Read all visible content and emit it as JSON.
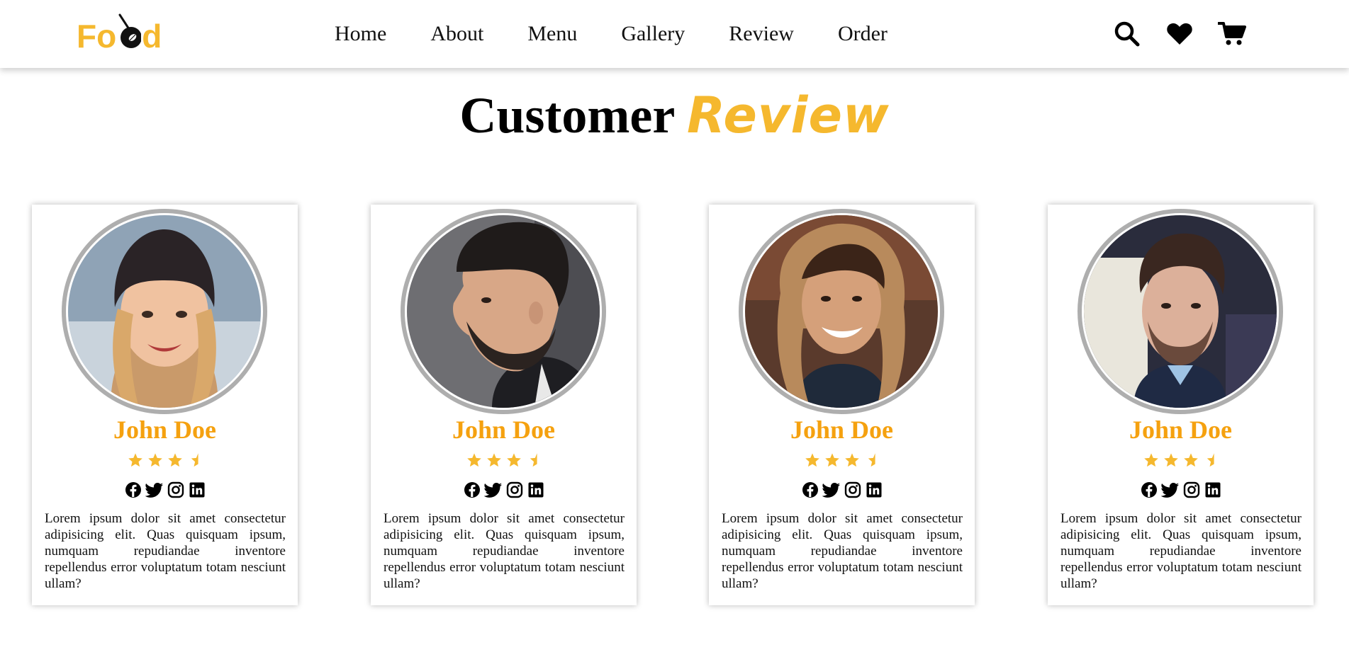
{
  "brand": {
    "logo_text_left": "Fo",
    "logo_text_right": "d",
    "color": "#f5b82e"
  },
  "nav": {
    "links": [
      {
        "label": "Home"
      },
      {
        "label": "About"
      },
      {
        "label": "Menu"
      },
      {
        "label": "Gallery"
      },
      {
        "label": "Review"
      },
      {
        "label": "Order"
      }
    ],
    "icons": [
      "search-icon",
      "heart-icon",
      "cart-icon"
    ]
  },
  "section": {
    "title_main": "Customer",
    "title_accent": "Review",
    "accent_color": "#f5b82e"
  },
  "reviews": [
    {
      "name": "John Doe",
      "rating": 3.5,
      "text": "Lorem ipsum dolor sit amet consectetur adipisicing elit. Quas quisquam ipsum, numquam repudiandae inventore repellendus error voluptatum totam nesciunt ullam?"
    },
    {
      "name": "John Doe",
      "rating": 3.5,
      "text": "Lorem ipsum dolor sit amet consectetur adipisicing elit. Quas quisquam ipsum, numquam repudiandae inventore repellendus error voluptatum totam nesciunt ullam?"
    },
    {
      "name": "John Doe",
      "rating": 3.5,
      "text": "Lorem ipsum dolor sit amet consectetur adipisicing elit. Quas quisquam ipsum, numquam repudiandae inventore repellendus error voluptatum totam nesciunt ullam?"
    },
    {
      "name": "John Doe",
      "rating": 3.5,
      "text": "Lorem ipsum dolor sit amet consectetur adipisicing elit. Quas quisquam ipsum, numquam repudiandae inventore repellendus error voluptatum totam nesciunt ullam?"
    }
  ],
  "social_icons": [
    "facebook-icon",
    "twitter-icon",
    "instagram-icon",
    "linkedin-icon"
  ],
  "colors": {
    "name": "#f5a10f",
    "star": "#f5b82e",
    "avatar_border": "#aeaeae"
  }
}
